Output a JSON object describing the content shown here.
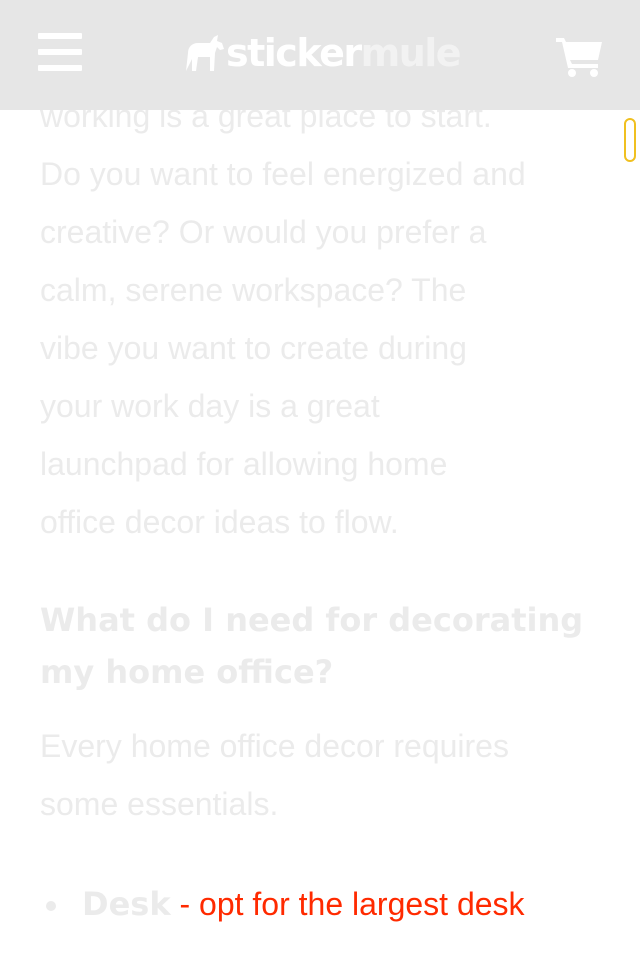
{
  "header": {
    "logo_part1": "sticker",
    "logo_part2": "mule",
    "menu_icon": "hamburger-menu-icon",
    "cart_icon": "shopping-cart-icon"
  },
  "article": {
    "paragraph_lines": [
      "working is a great place to start.",
      "Do you want to feel energized and",
      "creative? Or would you prefer a",
      "calm, serene workspace? The",
      "vibe you want to create during",
      "your work day is a great",
      "launchpad for allowing home",
      "office decor ideas to flow."
    ],
    "heading_lines": [
      "What do I need for decorating",
      "my home office?"
    ],
    "paragraph2_lines": [
      "Every home office decor requires",
      "some essentials."
    ],
    "list": [
      {
        "term": "Desk",
        "desc": " - opt for the largest desk"
      }
    ]
  },
  "colors": {
    "header_bg": "#e6e6e6",
    "faded_text": "#ebebeb",
    "link_red": "#ff2a00",
    "scroll_thumb_border": "#f0c020"
  }
}
